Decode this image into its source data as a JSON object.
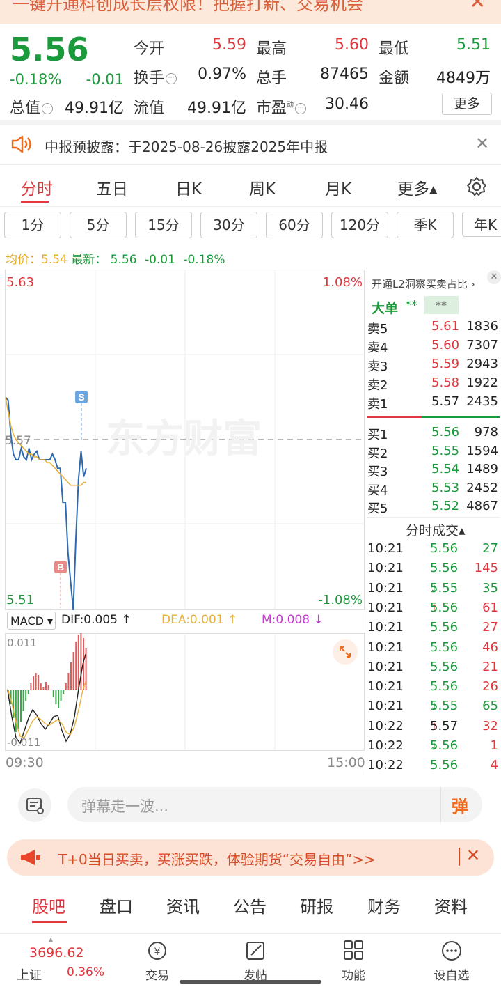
{
  "top_banner": {
    "text": "一键开通科创成长层权限！把握打新、交易机会",
    "close": "✕"
  },
  "quote": {
    "price": "5.56",
    "change_pct": "-0.18%",
    "change": "-0.01",
    "open_label": "今开",
    "open": "5.59",
    "high_label": "最高",
    "high": "5.60",
    "low_label": "最低",
    "low": "5.51",
    "turnover_label": "换手",
    "turnover": "0.97%",
    "volume_label": "总手",
    "volume": "87465",
    "amount_label": "金额",
    "amount": "4849万",
    "mktcap_label": "总值",
    "mktcap": "49.91亿",
    "float_label": "流值",
    "float_cap": "49.91亿",
    "pe_label": "市盈",
    "pe_sup": "动",
    "pe": "30.46",
    "more": "更多"
  },
  "notice": {
    "text": "中报预披露：于2025-08-26披露2025年中报",
    "close": "✕"
  },
  "period_tabs": [
    "分时",
    "五日",
    "日K",
    "周K",
    "月K",
    "更多▴"
  ],
  "kline_tabs": [
    "1分",
    "5分",
    "15分",
    "30分",
    "60分",
    "120分",
    "季K",
    "年K"
  ],
  "avg_line": {
    "avg_label": "均价：",
    "avg": "5.54",
    "latest_label": "最新：",
    "latest": "5.56",
    "chg": "-0.01",
    "pct": "-0.18%"
  },
  "chart": {
    "y_top": "5.63",
    "y_mid": "5.57",
    "y_bottom": "5.51",
    "pct_top": "1.08%",
    "pct_bottom": "-1.08%",
    "watermark": "东方财富",
    "marker_sell": "S",
    "marker_buy": "B",
    "time_start": "09:30",
    "time_end": "15:00"
  },
  "chart_data": {
    "type": "line",
    "title": "",
    "xlabel": "",
    "ylabel": "",
    "ylim": [
      5.51,
      5.63
    ],
    "series": [
      {
        "values": [
          5.585,
          5.584,
          5.572,
          5.565,
          5.563,
          5.563,
          5.567,
          5.564,
          5.563,
          5.567,
          5.563,
          5.565,
          5.566,
          5.563,
          5.563,
          5.563,
          5.563,
          5.563,
          5.565,
          5.563,
          5.56,
          5.56,
          5.548,
          5.548,
          5.53,
          5.52,
          5.51,
          5.535,
          5.556,
          5.566,
          5.557,
          5.56
        ]
      },
      {
        "values": [
          5.585,
          5.58,
          5.575,
          5.572,
          5.57,
          5.569,
          5.568,
          5.567,
          5.566,
          5.565,
          5.565,
          5.564,
          5.564,
          5.563,
          5.563,
          5.563,
          5.562,
          5.562,
          5.561,
          5.56,
          5.559,
          5.558,
          5.557,
          5.556,
          5.555,
          5.554,
          5.554,
          5.554,
          5.554,
          5.554,
          5.555,
          5.555
        ]
      }
    ]
  },
  "macd": {
    "label": "MACD ▾",
    "dif": "DIF:0.005 ↑",
    "dea": "DEA:0.001 ↑",
    "m": "M:0.008 ↓",
    "y_top": "0.011",
    "y_bottom": "-0.011"
  },
  "l2": {
    "link": "开通L2洞察买卖占比",
    "big_label": "大单",
    "big_val1": "**",
    "big_val2": "**"
  },
  "order_book": {
    "asks": [
      {
        "label": "卖5",
        "price": "5.61",
        "vol": "1836",
        "color": "#e0383e"
      },
      {
        "label": "卖4",
        "price": "5.60",
        "vol": "7307",
        "color": "#e0383e"
      },
      {
        "label": "卖3",
        "price": "5.59",
        "vol": "2943",
        "color": "#e0383e"
      },
      {
        "label": "卖2",
        "price": "5.58",
        "vol": "1922",
        "color": "#e0383e"
      },
      {
        "label": "卖1",
        "price": "5.57",
        "vol": "2435",
        "color": "#222222"
      }
    ],
    "bids": [
      {
        "label": "买1",
        "price": "5.56",
        "vol": "978",
        "color": "#1a9a3a"
      },
      {
        "label": "买2",
        "price": "5.55",
        "vol": "1594",
        "color": "#1a9a3a"
      },
      {
        "label": "买3",
        "price": "5.54",
        "vol": "1489",
        "color": "#1a9a3a"
      },
      {
        "label": "买4",
        "price": "5.53",
        "vol": "2452",
        "color": "#1a9a3a"
      },
      {
        "label": "买5",
        "price": "5.52",
        "vol": "4867",
        "color": "#1a9a3a"
      }
    ]
  },
  "trades": {
    "title": "分时成交▴",
    "rows": [
      {
        "time": "10:21",
        "price": "5.56",
        "arrow": "",
        "vol": "27",
        "pcolor": "#1a9a3a",
        "vcolor": "#1a9a3a"
      },
      {
        "time": "10:21",
        "price": "5.56",
        "arrow": "",
        "vol": "145",
        "pcolor": "#1a9a3a",
        "vcolor": "#e0383e"
      },
      {
        "time": "10:21",
        "price": "5.55",
        "arrow": "↓",
        "vol": "35",
        "pcolor": "#1a9a3a",
        "vcolor": "#1a9a3a"
      },
      {
        "time": "10:21",
        "price": "5.56",
        "arrow": "↑",
        "vol": "61",
        "pcolor": "#1a9a3a",
        "vcolor": "#e0383e"
      },
      {
        "time": "10:21",
        "price": "5.56",
        "arrow": "",
        "vol": "27",
        "pcolor": "#1a9a3a",
        "vcolor": "#e0383e"
      },
      {
        "time": "10:21",
        "price": "5.56",
        "arrow": "",
        "vol": "46",
        "pcolor": "#1a9a3a",
        "vcolor": "#e0383e"
      },
      {
        "time": "10:21",
        "price": "5.56",
        "arrow": "",
        "vol": "21",
        "pcolor": "#1a9a3a",
        "vcolor": "#e0383e"
      },
      {
        "time": "10:21",
        "price": "5.56",
        "arrow": "",
        "vol": "26",
        "pcolor": "#1a9a3a",
        "vcolor": "#e0383e"
      },
      {
        "time": "10:21",
        "price": "5.55",
        "arrow": "↓",
        "vol": "65",
        "pcolor": "#1a9a3a",
        "vcolor": "#1a9a3a"
      },
      {
        "time": "10:22",
        "price": "5.57",
        "arrow": "↑",
        "vol": "32",
        "pcolor": "#222222",
        "vcolor": "#e0383e"
      },
      {
        "time": "10:22",
        "price": "5.56",
        "arrow": "↓",
        "vol": "1",
        "pcolor": "#1a9a3a",
        "vcolor": "#e0383e"
      },
      {
        "time": "10:22",
        "price": "5.56",
        "arrow": "",
        "vol": "4",
        "pcolor": "#1a9a3a",
        "vcolor": "#e0383e"
      }
    ]
  },
  "danmu": {
    "placeholder": "弹幕走一波...",
    "btn": "弹"
  },
  "promo": {
    "text": "T+0当日买卖，买涨买跌，体验期货“交易自由”>>",
    "close": "✕"
  },
  "bottom_tabs": [
    "股吧",
    "盘口",
    "资讯",
    "公告",
    "研报",
    "财务",
    "资料"
  ],
  "index": {
    "value": "3696.62",
    "name": "上证",
    "pct": "0.36%"
  },
  "nav": [
    {
      "label": "交易",
      "icon": "trade-icon"
    },
    {
      "label": "发帖",
      "icon": "post-icon"
    },
    {
      "label": "功能",
      "icon": "function-icon"
    },
    {
      "label": "设自选",
      "icon": "watchlist-icon"
    }
  ],
  "colors": {
    "up": "#e0383e",
    "down": "#1a9a3a",
    "accent": "#e0383e",
    "price_line": "#2e6ab0",
    "avg_line": "#e8b23a"
  }
}
